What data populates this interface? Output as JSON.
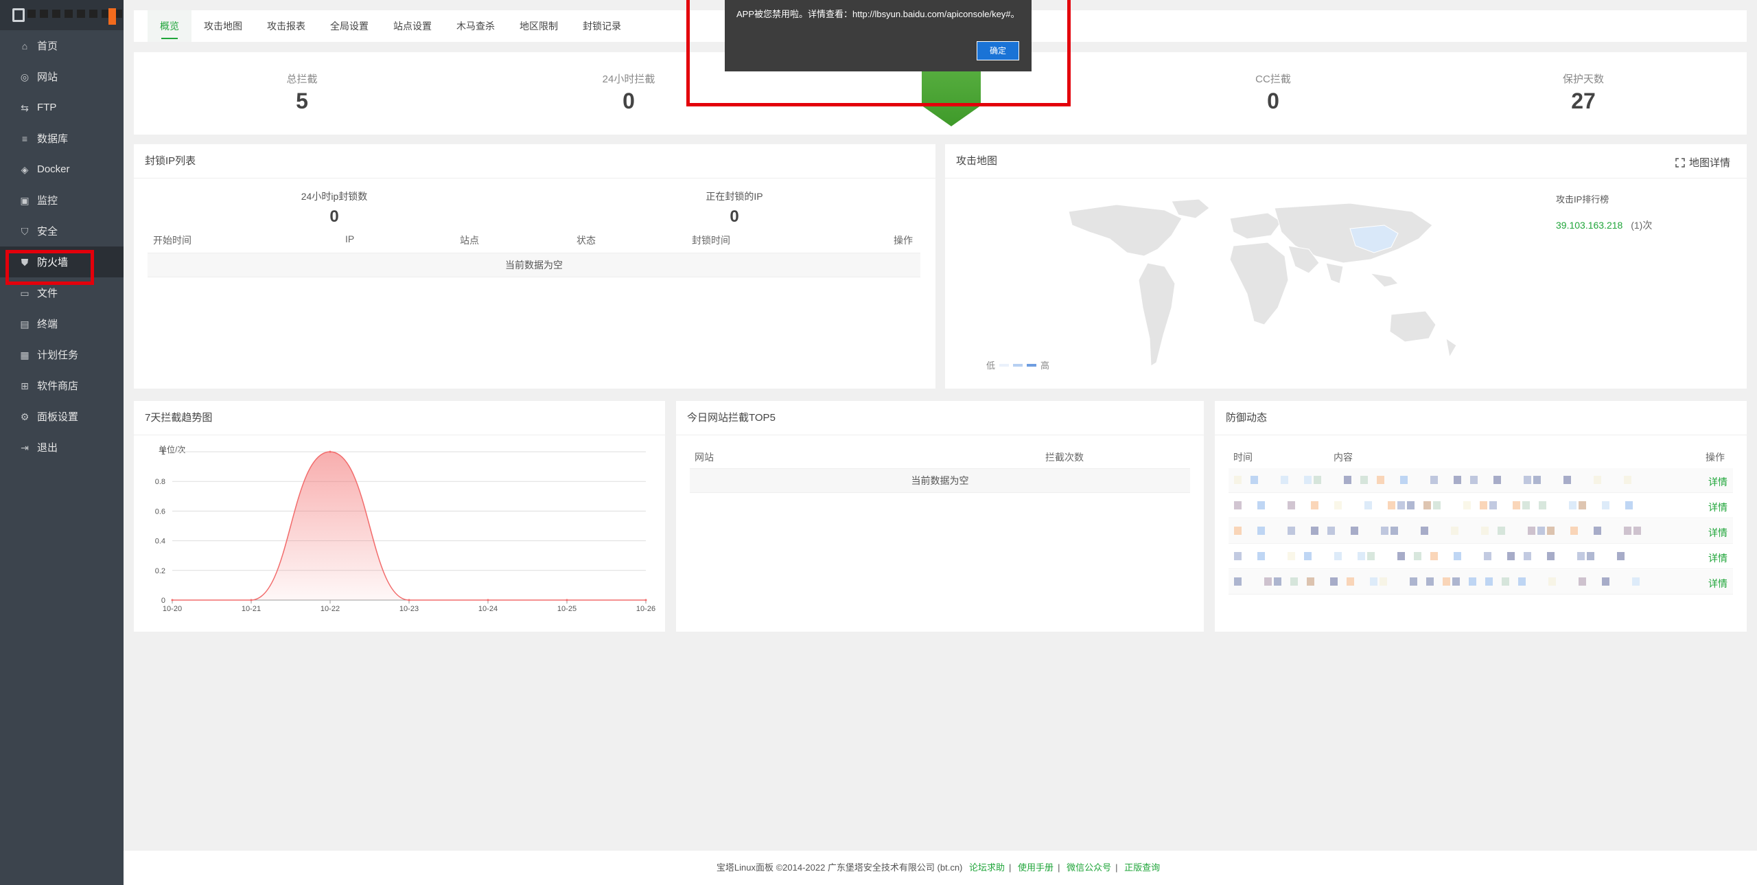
{
  "sidebar": {
    "items": [
      {
        "label": "首页",
        "icon": "home-icon"
      },
      {
        "label": "网站",
        "icon": "globe-icon"
      },
      {
        "label": "FTP",
        "icon": "ftp-icon"
      },
      {
        "label": "数据库",
        "icon": "database-icon"
      },
      {
        "label": "Docker",
        "icon": "docker-icon"
      },
      {
        "label": "监控",
        "icon": "monitor-icon"
      },
      {
        "label": "安全",
        "icon": "shield-check-icon"
      },
      {
        "label": "防火墙",
        "icon": "firewall-icon"
      },
      {
        "label": "文件",
        "icon": "folder-icon"
      },
      {
        "label": "终端",
        "icon": "terminal-icon"
      },
      {
        "label": "计划任务",
        "icon": "calendar-icon"
      },
      {
        "label": "软件商店",
        "icon": "apps-icon"
      },
      {
        "label": "面板设置",
        "icon": "gear-icon"
      },
      {
        "label": "退出",
        "icon": "logout-icon"
      }
    ]
  },
  "tabs": [
    "概览",
    "攻击地图",
    "攻击报表",
    "全局设置",
    "站点设置",
    "木马查杀",
    "地区限制",
    "封锁记录"
  ],
  "stats": [
    {
      "label": "总拦截",
      "value": "5"
    },
    {
      "label": "24小时拦截",
      "value": "0"
    },
    {
      "label": "CC拦截",
      "value": "0"
    },
    {
      "label": "保护天数",
      "value": "27"
    }
  ],
  "blockip": {
    "title": "封锁IP列表",
    "stat1_label": "24小时ip封锁数",
    "stat1_value": "0",
    "stat2_label": "正在封锁的IP",
    "stat2_value": "0",
    "columns": [
      "开始时间",
      "IP",
      "站点",
      "状态",
      "封锁时间",
      "操作"
    ],
    "empty": "当前数据为空"
  },
  "attackmap": {
    "title": "攻击地图",
    "detail": "地图详情",
    "rank_title": "攻击IP排行榜",
    "rank_ip": "39.103.163.218",
    "rank_count": "(1)次",
    "legend_low": "低",
    "legend_high": "高"
  },
  "trend": {
    "title": "7天拦截趋势图",
    "unit": "单位/次"
  },
  "chart_data": {
    "type": "area",
    "categories": [
      "10-20",
      "10-21",
      "10-22",
      "10-23",
      "10-24",
      "10-25",
      "10-26"
    ],
    "values": [
      0,
      0,
      1,
      0,
      0,
      0,
      0
    ],
    "ylim": [
      0,
      1
    ],
    "yticks": [
      "0",
      "0.2",
      "0.4",
      "0.6",
      "0.8",
      "1"
    ],
    "color": "#f26b6b"
  },
  "top5": {
    "title": "今日网站拦截TOP5",
    "col1": "网站",
    "col2": "拦截次数",
    "empty": "当前数据为空"
  },
  "defense": {
    "title": "防御动态",
    "col_time": "时间",
    "col_content": "内容",
    "col_action": "操作",
    "detail_label": "详情"
  },
  "footer": {
    "copyright": "宝塔Linux面板 ©2014-2022 广东堡塔安全技术有限公司 (bt.cn)",
    "links": [
      "论坛求助",
      "使用手册",
      "微信公众号",
      "正版查询"
    ]
  },
  "dialog": {
    "message": "APP被您禁用啦。详情查看：http://lbsyun.baidu.com/apiconsole/key#。",
    "ok": "确定"
  }
}
